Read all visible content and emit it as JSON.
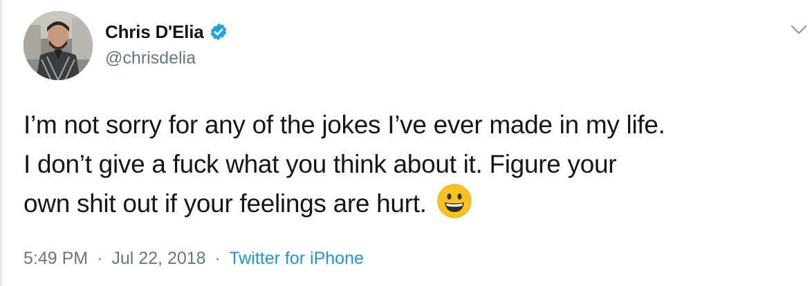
{
  "author": {
    "display_name": "Chris D'Elia",
    "handle": "@chrisdelia",
    "verified": true
  },
  "tweet": {
    "lines": [
      "I’m not sorry for any of the jokes I’ve ever made in my life.",
      "I don’t give a fuck what you think about it. Figure your",
      "own shit out if your feelings are hurt."
    ],
    "emoji": "grinning-face-icon"
  },
  "meta": {
    "time": "5:49 PM",
    "separator": "·",
    "date": "Jul 22, 2018",
    "source": "Twitter for iPhone"
  },
  "colors": {
    "text": "#14171a",
    "secondary": "#657786",
    "link": "#1b95e0",
    "verified": "#1da1f2",
    "emoji": "#fcc21b"
  }
}
